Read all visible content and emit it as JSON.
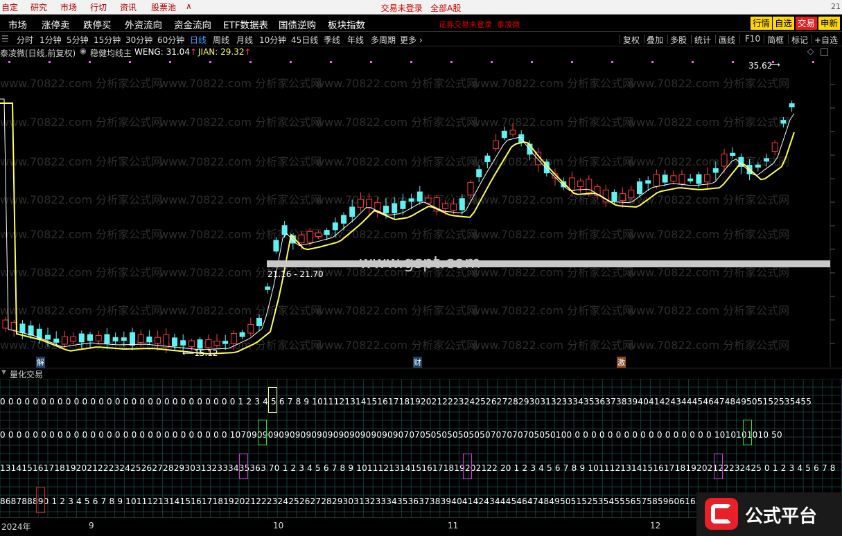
{
  "top_menu": {
    "items": [
      "自定",
      "研究",
      "市场",
      "行切",
      "资讯",
      "股票池",
      "∧"
    ],
    "center_left": "交易未登录",
    "center_right": "全部A股",
    "right_num": "21"
  },
  "nav": {
    "items": [
      "市场",
      "涨停卖",
      "跌停买",
      "外资流向",
      "资金流向",
      "ETF数据表",
      "国债逆购",
      "板块指数"
    ],
    "status_text": "证券交易未登录",
    "stock_name": "泰凌微",
    "right_buttons": [
      "行情",
      "自选",
      "交易",
      "申新"
    ]
  },
  "periods": {
    "items": [
      "分时",
      "1分钟",
      "5分钟",
      "15分钟",
      "30分钟",
      "60分钟",
      "日线",
      "周线",
      "月线",
      "10分钟",
      "45日线",
      "季线",
      "年线",
      "多周期",
      "更多 ›"
    ],
    "active": "日线"
  },
  "tools": [
    "复权",
    "叠加",
    "多股",
    "统计",
    "画线",
    "F10",
    "简框",
    "标记",
    "+自选"
  ],
  "indicator": {
    "title": "泰凌微(日线,前复权)",
    "name": "稳健均线主",
    "weng_label": "WENG:",
    "weng_value": "31.04",
    "jian_label": "JIAN:",
    "jian_value": "29.32"
  },
  "chart": {
    "watermark_site": "www.gspt.com",
    "watermark_text": "www.70822.com 分析家公式网",
    "high_label": "35.62",
    "low_label": "15.12",
    "range_label": "21.16 - 21.70",
    "event_labels": [
      "解",
      "财",
      "激"
    ],
    "colors": {
      "up": "#ff3b3b",
      "down": "#5ef2f2",
      "weng": "#ffffff",
      "jian": "#ffff55",
      "marker": "#ff55ff"
    }
  },
  "sub_panel": {
    "title": "量化交易",
    "rows": [
      "0 0 0 0 0 0 0 0 0 0 0 0 0 0 0 0 0 0 0 0 0 0 0 0 0 0 0 0 0 1 2 3 4 5 6 7 8 9 10111213141516171819202122232425262728293031323334353637383940414243444546474849505152535455",
      "0 0 0 0 0 0 0 0 0 0 0 0 0 0 0 0 0 0 0 0 0 0 0 0 0 0 0 0 107090909090909090909090909090907070505050505050707070705050100 0 0 0 0 0 0 0 0 0 0 0 0 0 0 0 0 0 1010101010 50",
      "1314151617181920212223242526272829303132333435363 70 1 2 3 4 5 6 7 8 9 10111213141516171819202122 20 1 2 3 4 5 6 7 8 9 10111213141516171819202122232425 0 1 2 3 4 5 6 7 8",
      "868788890 1 2 3 4 5 6 7 8 9 1011121314151617181920212223242526272829303132333435363738394041424344454647484950515253545556575859606162636465666 7"
    ]
  },
  "time_axis": {
    "labels": [
      "2024年",
      "9",
      "10",
      "11",
      "12"
    ]
  },
  "logo": {
    "text": "公式平台"
  }
}
